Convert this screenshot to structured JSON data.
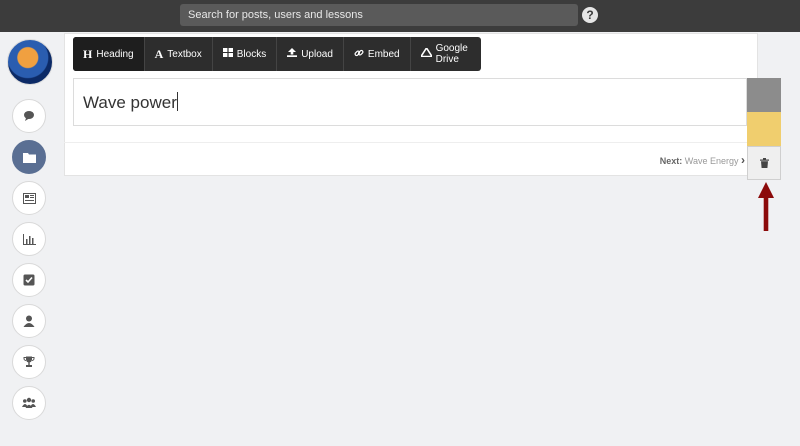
{
  "header": {
    "search_placeholder": "Search for posts, users and lessons",
    "help_glyph": "?"
  },
  "toolbar": {
    "items": [
      {
        "icon": "heading-icon",
        "glyph": "H",
        "label": "Heading"
      },
      {
        "icon": "textbox-icon",
        "glyph": "A",
        "label": "Textbox"
      },
      {
        "icon": "blocks-icon",
        "glyph": "▦",
        "label": "Blocks"
      },
      {
        "icon": "upload-icon",
        "glyph": "⬆",
        "label": "Upload"
      },
      {
        "icon": "embed-icon",
        "glyph": "⚲",
        "label": "Embed"
      },
      {
        "icon": "google-drive-icon",
        "glyph": "▲",
        "label": "Google Drive"
      }
    ]
  },
  "editor": {
    "text": "Wave power"
  },
  "footer": {
    "next_label": "Next:",
    "next_title": "Wave Energy",
    "chevron": "›"
  },
  "sidebar": {
    "items": [
      {
        "name": "comments-icon",
        "glyph": "💬",
        "active": false
      },
      {
        "name": "folder-icon",
        "glyph": "▰",
        "active": true
      },
      {
        "name": "news-icon",
        "glyph": "▤",
        "active": false
      },
      {
        "name": "chart-icon",
        "glyph": "▥",
        "active": false
      },
      {
        "name": "check-icon",
        "glyph": "☑",
        "active": false
      },
      {
        "name": "user-icon",
        "glyph": "●",
        "active": false
      },
      {
        "name": "trophy-icon",
        "glyph": "♛",
        "active": false
      },
      {
        "name": "group-icon",
        "glyph": "⚇",
        "active": false
      }
    ]
  },
  "colors": {
    "topbar": "#3c3c3c",
    "active_nav": "#5a6f93",
    "swatch_grey": "#8c8c8c",
    "swatch_yellow": "#f0ce6e",
    "arrow": "#8b0a0a"
  }
}
